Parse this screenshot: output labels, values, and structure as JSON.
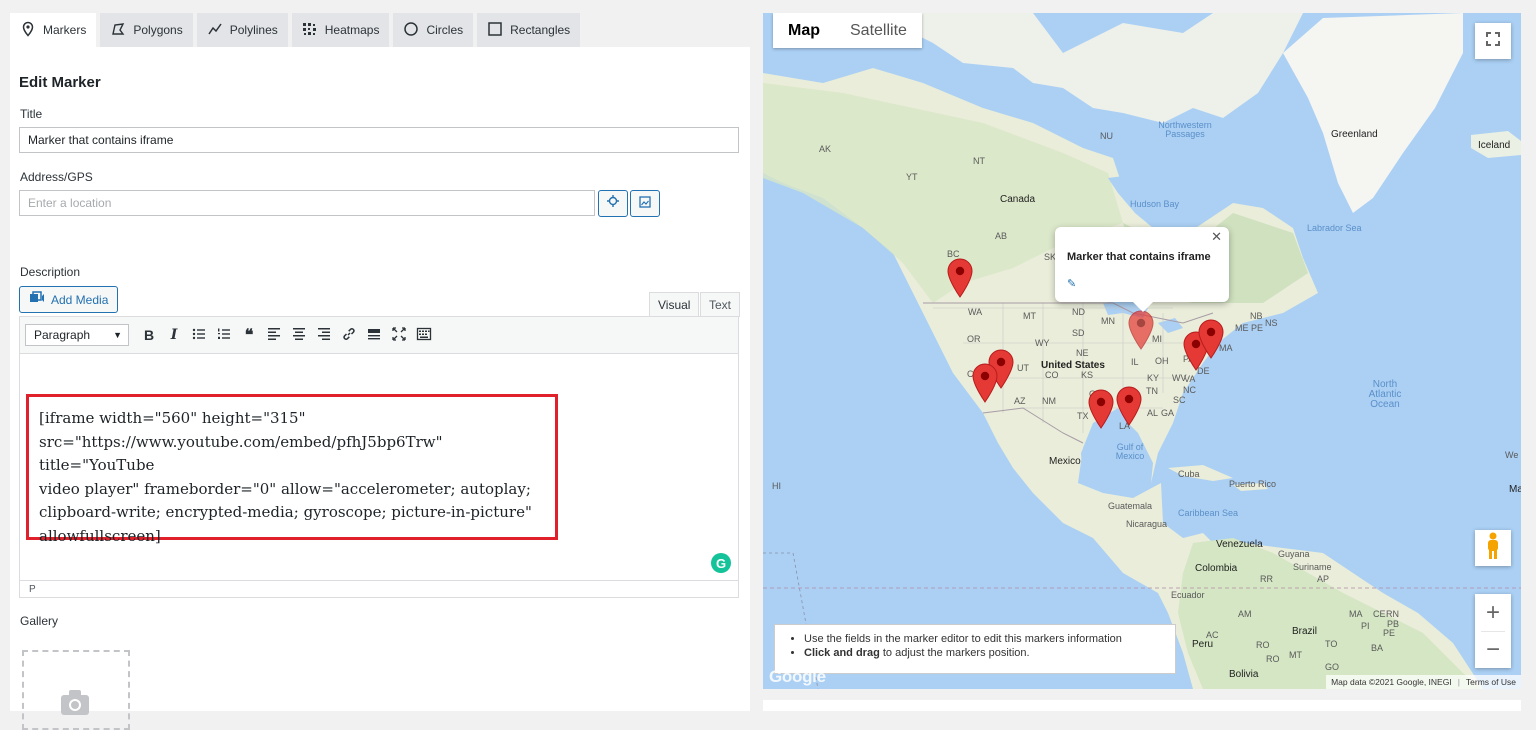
{
  "tabs": [
    {
      "label": "Markers",
      "icon": "map-pin-icon"
    },
    {
      "label": "Polygons",
      "icon": "polygon-icon"
    },
    {
      "label": "Polylines",
      "icon": "polyline-icon"
    },
    {
      "label": "Heatmaps",
      "icon": "heatmap-icon"
    },
    {
      "label": "Circles",
      "icon": "circle-icon"
    },
    {
      "label": "Rectangles",
      "icon": "rectangle-icon"
    }
  ],
  "editor": {
    "heading": "Edit Marker",
    "title_label": "Title",
    "title_value": "Marker that contains iframe",
    "address_label": "Address/GPS",
    "address_placeholder": "Enter a location",
    "description_label": "Description",
    "add_media": "Add Media",
    "visual_tab": "Visual",
    "text_tab": "Text",
    "format_select": "Paragraph",
    "content_lines": [
      "[iframe width=\"560\" height=\"315\"",
      "src=\"https://www.youtube.com/embed/pfhJ5bp6Trw\" title=\"YouTube",
      "video player\" frameborder=\"0\" allow=\"accelerometer; autoplay;",
      "clipboard-write; encrypted-media; gyroscope; picture-in-picture\"",
      "allowfullscreen]"
    ],
    "status_path": "P",
    "gallery_label": "Gallery",
    "grammarly_letter": "G"
  },
  "map": {
    "type_map": "Map",
    "type_satellite": "Satellite",
    "info_title": "Marker that contains iframe",
    "hint_1": "Use the fields in the marker editor to edit this markers information",
    "hint_2_bold": "Click and drag",
    "hint_2_rest": " to adjust the markers position.",
    "attribution": "Map data ©2021 Google, INEGI",
    "terms": "Terms of Use",
    "google": "Google",
    "zoom_in": "+",
    "zoom_out": "−",
    "labels": {
      "greenland": "Greenland",
      "iceland": "Iceland",
      "canada": "Canada",
      "hudson_bay": "Hudson Bay",
      "labrador_sea": "Labrador Sea",
      "northwest_passages": "Northwestern Passages",
      "united_states": "United States",
      "north_atlantic": "North Atlantic Ocean",
      "gulf": "Gulf of Mexico",
      "mexico": "Mexico",
      "cuba": "Cuba",
      "puerto_rico": "Puerto Rico",
      "guatemala": "Guatemala",
      "nicaragua": "Nicaragua",
      "caribbean": "Caribbean Sea",
      "venezuela": "Venezuela",
      "colombia": "Colombia",
      "guyana": "Guyana",
      "suriname": "Suriname",
      "ecuador": "Ecuador",
      "peru": "Peru",
      "brazil": "Brazil",
      "bolivia": "Bolivia",
      "ak": "AK",
      "nu": "NU",
      "nt": "NT",
      "yt": "YT",
      "bc": "BC",
      "ab": "AB",
      "sk": "SK",
      "wa": "WA",
      "or": "OR",
      "mt": "MT",
      "nd": "ND",
      "sd": "SD",
      "wy": "WY",
      "ne": "NE",
      "ut": "UT",
      "co": "CO",
      "ks": "KS",
      "az": "AZ",
      "nm": "NM",
      "tx": "TX",
      "la": "LA",
      "ok": "OK",
      "mn": "MN",
      "mi": "MI",
      "il": "IL",
      "ky": "KY",
      "tn": "TN",
      "al": "AL",
      "ga": "GA",
      "sc": "SC",
      "nc": "NC",
      "va": "VA",
      "wv": "WV",
      "oh": "OH",
      "pa": "PA",
      "de": "DE",
      "ma": "MA",
      "me": "ME",
      "nb": "NB",
      "ns": "NS",
      "pe": "PE",
      "ca": "CA",
      "hi": "HI",
      "ap": "AP",
      "rr": "RR",
      "am": "AM",
      "ac": "AC",
      "ro": "RO",
      "to": "TO",
      "ba": "BA",
      "mt2": "MT",
      "go": "GO",
      "pi": "PI",
      "ma2": "MA",
      "ce": "CE",
      "rn": "RN",
      "pb": "PB",
      "pe2": "PE",
      "ro2": "RO",
      "we": "We",
      "ma3": "Ma"
    }
  }
}
